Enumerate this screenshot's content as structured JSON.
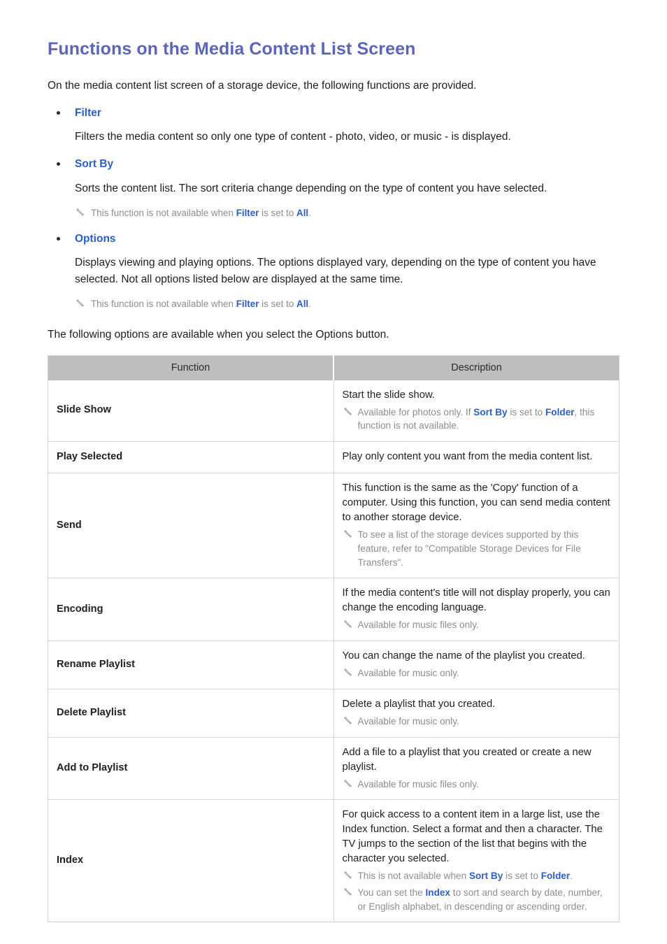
{
  "document": {
    "title": "Functions on the Media Content List Screen",
    "intro": "On the media content list screen of a storage device, the following functions are provided."
  },
  "sections": [
    {
      "label": "Filter",
      "body": "Filters the media content so only one type of content - photo, video, or music - is displayed.",
      "notes": []
    },
    {
      "label": "Sort By",
      "body": "Sorts the content list. The sort criteria change depending on the type of content you have selected.",
      "notes": [
        {
          "icon": "pencil-icon",
          "parts": [
            {
              "text": "This function is not available when ",
              "link": false
            },
            {
              "text": "Filter",
              "link": true
            },
            {
              "text": " is set to ",
              "link": false
            },
            {
              "text": "All",
              "link": true
            },
            {
              "text": ".",
              "link": false
            }
          ]
        }
      ]
    },
    {
      "label": "Options",
      "body": "Displays viewing and playing options. The options displayed vary, depending on the type of content you have selected. Not all options listed below are displayed at the same time.",
      "notes": [
        {
          "icon": "pencil-icon",
          "parts": [
            {
              "text": "This function is not available when ",
              "link": false
            },
            {
              "text": "Filter",
              "link": true
            },
            {
              "text": " is set to ",
              "link": false
            },
            {
              "text": "All",
              "link": true
            },
            {
              "text": ".",
              "link": false
            }
          ]
        }
      ]
    }
  ],
  "table_intro": "The following options are available when you select the Options button.",
  "table": {
    "headers": [
      "Function",
      "Description"
    ],
    "rows": [
      {
        "function": "Slide Show",
        "description": "Start the slide show.",
        "notes": [
          {
            "icon": "pencil-icon",
            "parts": [
              {
                "text": "Available for photos only. If ",
                "link": false
              },
              {
                "text": "Sort By",
                "link": true
              },
              {
                "text": " is set to ",
                "link": false
              },
              {
                "text": "Folder",
                "link": true
              },
              {
                "text": ", this function is not available.",
                "link": false
              }
            ]
          }
        ]
      },
      {
        "function": "Play Selected",
        "description": "Play only content you want from the media content list.",
        "notes": []
      },
      {
        "function": "Send",
        "description": "This function is the same as the 'Copy' function of a computer. Using this function, you can send media content to another storage device.",
        "notes": [
          {
            "icon": "pencil-icon",
            "parts": [
              {
                "text": "To see a list of the storage devices supported by this feature, refer to \"Compatible Storage Devices for File Transfers\".",
                "link": false
              }
            ]
          }
        ]
      },
      {
        "function": "Encoding",
        "description": "If the media content's title will not display properly, you can change the encoding language.",
        "notes": [
          {
            "icon": "pencil-icon",
            "parts": [
              {
                "text": "Available for music files only.",
                "link": false
              }
            ]
          }
        ]
      },
      {
        "function": "Rename Playlist",
        "description": "You can change the name of the playlist you created.",
        "notes": [
          {
            "icon": "pencil-icon",
            "parts": [
              {
                "text": "Available for music only.",
                "link": false
              }
            ]
          }
        ]
      },
      {
        "function": "Delete Playlist",
        "description": "Delete a playlist that you created.",
        "notes": [
          {
            "icon": "pencil-icon",
            "parts": [
              {
                "text": "Available for music only.",
                "link": false
              }
            ]
          }
        ]
      },
      {
        "function": "Add to Playlist",
        "description": "Add a file to a playlist that you created or create a new playlist.",
        "notes": [
          {
            "icon": "pencil-icon",
            "parts": [
              {
                "text": "Available for music files only.",
                "link": false
              }
            ]
          }
        ]
      },
      {
        "function": "Index",
        "description": "For quick access to a content item in a large list, use the Index function. Select a format and then a character. The TV jumps to the section of the list that begins with the character you selected.",
        "notes": [
          {
            "icon": "pencil-icon",
            "parts": [
              {
                "text": "This is not available when ",
                "link": false
              },
              {
                "text": "Sort By",
                "link": true
              },
              {
                "text": " is set to ",
                "link": false
              },
              {
                "text": "Folder",
                "link": true
              },
              {
                "text": ".",
                "link": false
              }
            ]
          },
          {
            "icon": "pencil-icon",
            "parts": [
              {
                "text": "You can set the ",
                "link": false
              },
              {
                "text": "Index",
                "link": true
              },
              {
                "text": " to sort and search by date, number, or English alphabet, in descending or ascending order.",
                "link": false
              }
            ]
          }
        ]
      }
    ]
  },
  "colors": {
    "heading": "#5b66bb",
    "link": "#2b5fc4",
    "note_text": "#8d8d8d",
    "table_header_bg": "#bebebe",
    "table_border": "#d6d6d6",
    "body_text": "#1f1f1f"
  }
}
